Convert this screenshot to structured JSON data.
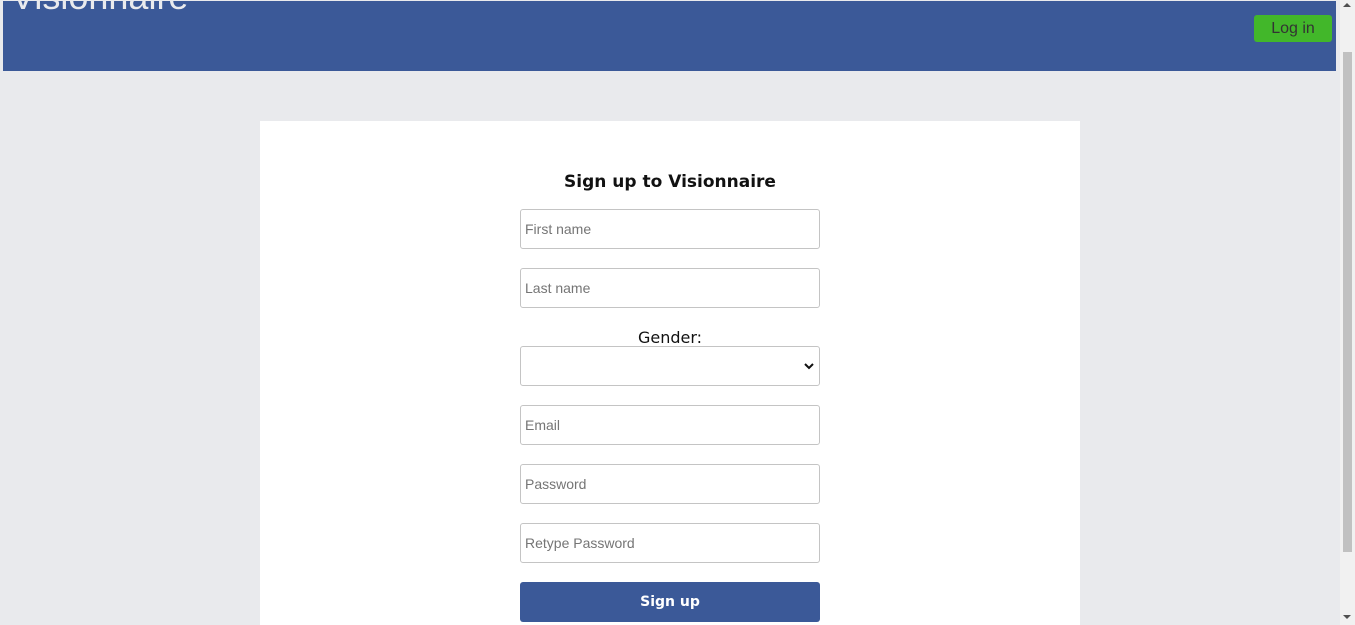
{
  "header": {
    "brand": "Visionnaire",
    "login_label": "Log in"
  },
  "form": {
    "title": "Sign up to Visionnaire",
    "first_name_placeholder": "First name",
    "last_name_placeholder": "Last name",
    "gender_label": "Gender:",
    "gender_selected": "",
    "email_placeholder": "Email",
    "password_placeholder": "Password",
    "retype_password_placeholder": "Retype Password",
    "submit_label": "Sign up"
  },
  "colors": {
    "brand_blue": "#3b5998",
    "login_green": "#42b72a",
    "page_background": "#e9eaed"
  }
}
